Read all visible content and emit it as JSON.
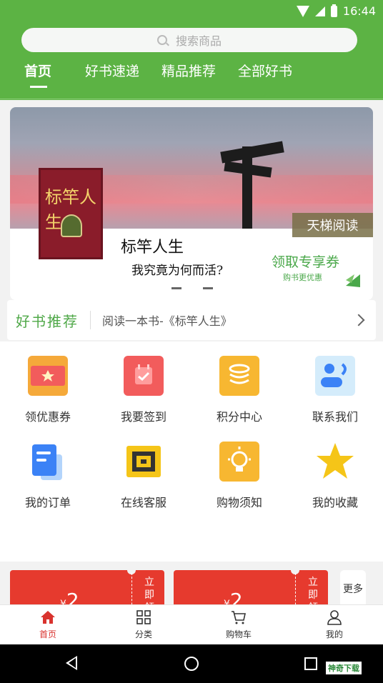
{
  "status_bar": {
    "time": "16:44"
  },
  "search": {
    "placeholder": "搜索商品"
  },
  "tabs": [
    {
      "label": "首页",
      "active": true
    },
    {
      "label": "好书速递"
    },
    {
      "label": "精品推荐"
    },
    {
      "label": "全部好书"
    }
  ],
  "banner": {
    "book_cover_title": "标竿人生",
    "tag": "天梯阅读",
    "book_name": "标竿人生",
    "subtitle": "我究竟为何而活?",
    "coupon_text": "领取专享券",
    "coupon_sub": "购书更优惠"
  },
  "recommendation": {
    "label": "好书推荐",
    "text": "阅读一本书-《标竿人生》"
  },
  "grid": [
    {
      "label": "领优惠券",
      "icon": "coupon-icon",
      "color": "#f5a93a"
    },
    {
      "label": "我要签到",
      "icon": "calendar-icon",
      "color": "#f25c5c"
    },
    {
      "label": "积分中心",
      "icon": "coins-icon",
      "color": "#f7b731"
    },
    {
      "label": "联系我们",
      "icon": "contact-icon",
      "color": "#3b82f6"
    },
    {
      "label": "我的订单",
      "icon": "order-icon",
      "color": "#3b82f6"
    },
    {
      "label": "在线客服",
      "icon": "headset-icon",
      "color": "#f5c518"
    },
    {
      "label": "购物须知",
      "icon": "bulb-icon",
      "color": "#f7b731"
    },
    {
      "label": "我的收藏",
      "icon": "star-icon",
      "color": "#f5c518"
    }
  ],
  "coupons": [
    {
      "currency": "¥",
      "amount": "2",
      "action": "立即领"
    },
    {
      "currency": "¥",
      "amount": "2",
      "action": "立即领"
    }
  ],
  "more": "更多",
  "bottom_nav": [
    {
      "label": "首页",
      "icon": "home-icon",
      "active": true
    },
    {
      "label": "分类",
      "icon": "grid-icon"
    },
    {
      "label": "购物车",
      "icon": "cart-icon"
    },
    {
      "label": "我的",
      "icon": "user-icon"
    }
  ],
  "watermark": "神奇下载",
  "colors": {
    "primary": "#5cb344",
    "accent": "#e63a2e",
    "active_nav": "#d9332e"
  }
}
